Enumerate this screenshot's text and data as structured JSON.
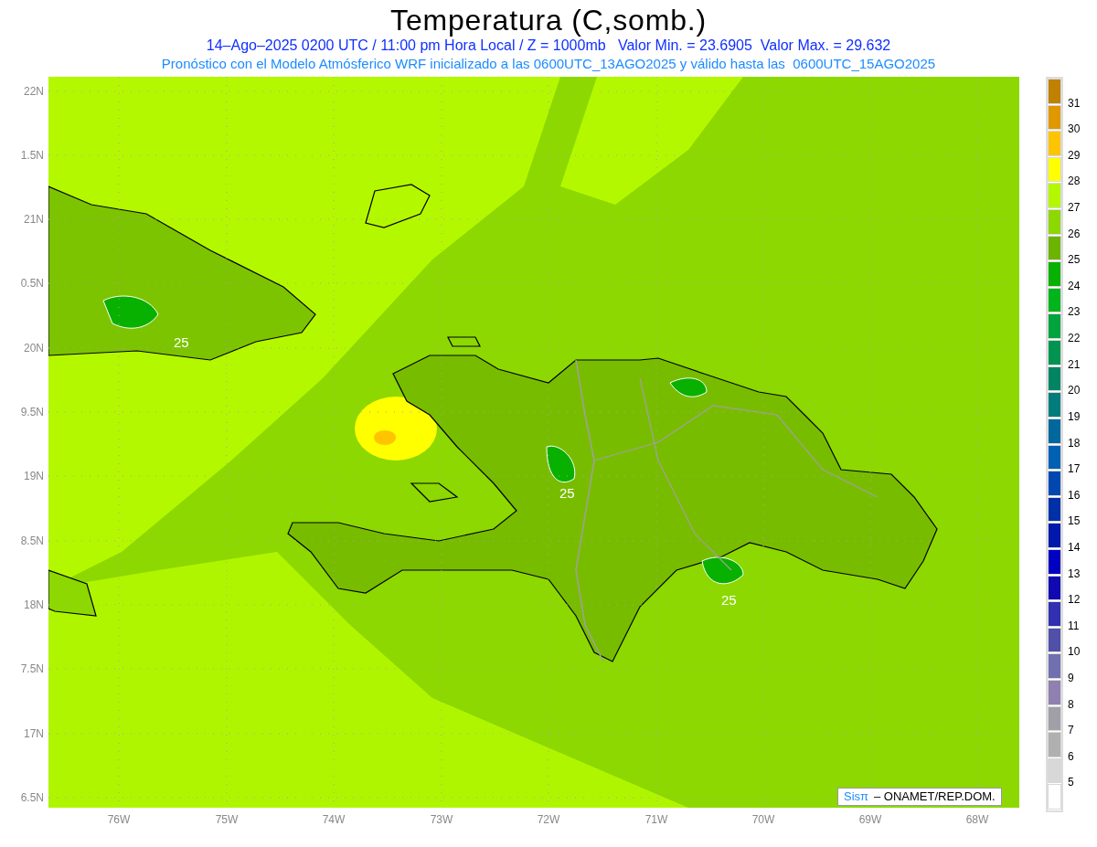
{
  "title": "Temperatura (C,somb.)",
  "subtitle": "14–Ago–2025 0200 UTC / 11:00 pm Hora Local / Z = 1000mb   Valor Min. = 23.6905  Valor Max. = 29.632",
  "forecast_note": "Pronóstico con el Modelo Atmósferico WRF inicializado a las 0600UTC_13AGO2025 y válido hasta las  0600UTC_15AGO2025",
  "y_axis": [
    "22N",
    "1.5N",
    "21N",
    "0.5N",
    "20N",
    "9.5N",
    "19N",
    "8.5N",
    "18N",
    "7.5N",
    "17N",
    "6.5N"
  ],
  "x_axis": [
    "76W",
    "75W",
    "74W",
    "73W",
    "72W",
    "71W",
    "70W",
    "69W",
    "68W"
  ],
  "contour_labels": [
    "25",
    "25",
    "25"
  ],
  "colorbar": [
    {
      "color": "#c08000",
      "label": "31"
    },
    {
      "color": "#e09800",
      "label": "30"
    },
    {
      "color": "#ffc400",
      "label": "29"
    },
    {
      "color": "#ffff00",
      "label": "28"
    },
    {
      "color": "#b4f800",
      "label": "27"
    },
    {
      "color": "#8cd800",
      "label": "26"
    },
    {
      "color": "#6cb400",
      "label": "25"
    },
    {
      "color": "#08b000",
      "label": "24"
    },
    {
      "color": "#00b41c",
      "label": "23"
    },
    {
      "color": "#00a43c",
      "label": "22"
    },
    {
      "color": "#009450",
      "label": "21"
    },
    {
      "color": "#008464",
      "label": "20"
    },
    {
      "color": "#007c7c",
      "label": "19"
    },
    {
      "color": "#00689c",
      "label": "18"
    },
    {
      "color": "#0060b4",
      "label": "17"
    },
    {
      "color": "#0048b0",
      "label": "16"
    },
    {
      "color": "#0030a8",
      "label": "15"
    },
    {
      "color": "#0018ac",
      "label": "14"
    },
    {
      "color": "#0000c0",
      "label": "13"
    },
    {
      "color": "#1008b0",
      "label": "12"
    },
    {
      "color": "#3030b0",
      "label": "11"
    },
    {
      "color": "#5050a8",
      "label": "10"
    },
    {
      "color": "#7070b0",
      "label": "9"
    },
    {
      "color": "#9080b0",
      "label": "8"
    },
    {
      "color": "#a0a0a8",
      "label": "7"
    },
    {
      "color": "#b0b0b0",
      "label": "6"
    },
    {
      "color": "#d8d8d8",
      "label": "5"
    },
    {
      "color": "#ffffff"
    }
  ],
  "credit": {
    "brand": "Sisπ",
    "text": "– ONAMET/REP.DOM."
  }
}
